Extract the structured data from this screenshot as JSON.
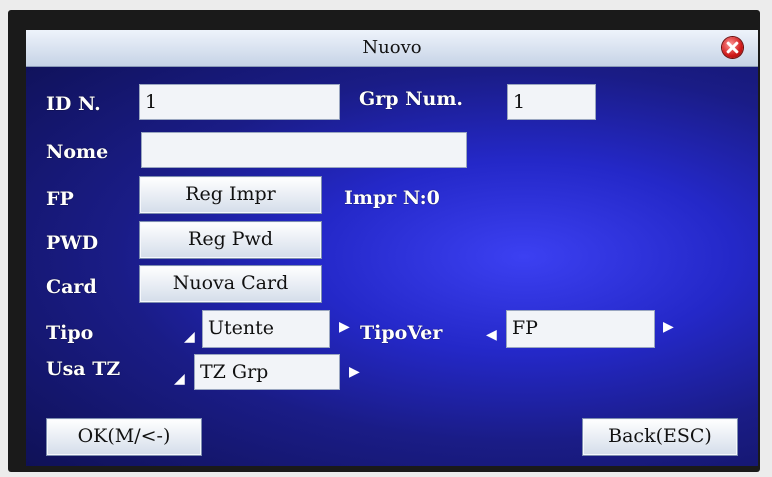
{
  "window": {
    "title": "Nuovo"
  },
  "form": {
    "id_label": "ID N.",
    "id_value": "1",
    "grp_label": "Grp Num.",
    "grp_value": "1",
    "nome_label": "Nome",
    "nome_value": "",
    "fp_label": "FP",
    "fp_button": "Reg Impr",
    "impr_count": "Impr N:0",
    "pwd_label": "PWD",
    "pwd_button": "Reg Pwd",
    "card_label": "Card",
    "card_button": "Nuova Card",
    "tipo_label": "Tipo",
    "tipo_value": "Utente",
    "tipover_label": "TipoVer",
    "tipover_value": "FP",
    "usatz_label": "Usa TZ",
    "usatz_value": "TZ Grp"
  },
  "footer": {
    "ok_button": "OK(M/<-)",
    "back_button": "Back(ESC)"
  },
  "icons": {
    "close": "close-icon",
    "arrow_left": "arrow-left-icon",
    "arrow_right": "arrow-right-icon"
  },
  "colors": {
    "screen_bg": "#2428c8",
    "titlebar": "#dde6f2",
    "close": "#d01818"
  }
}
